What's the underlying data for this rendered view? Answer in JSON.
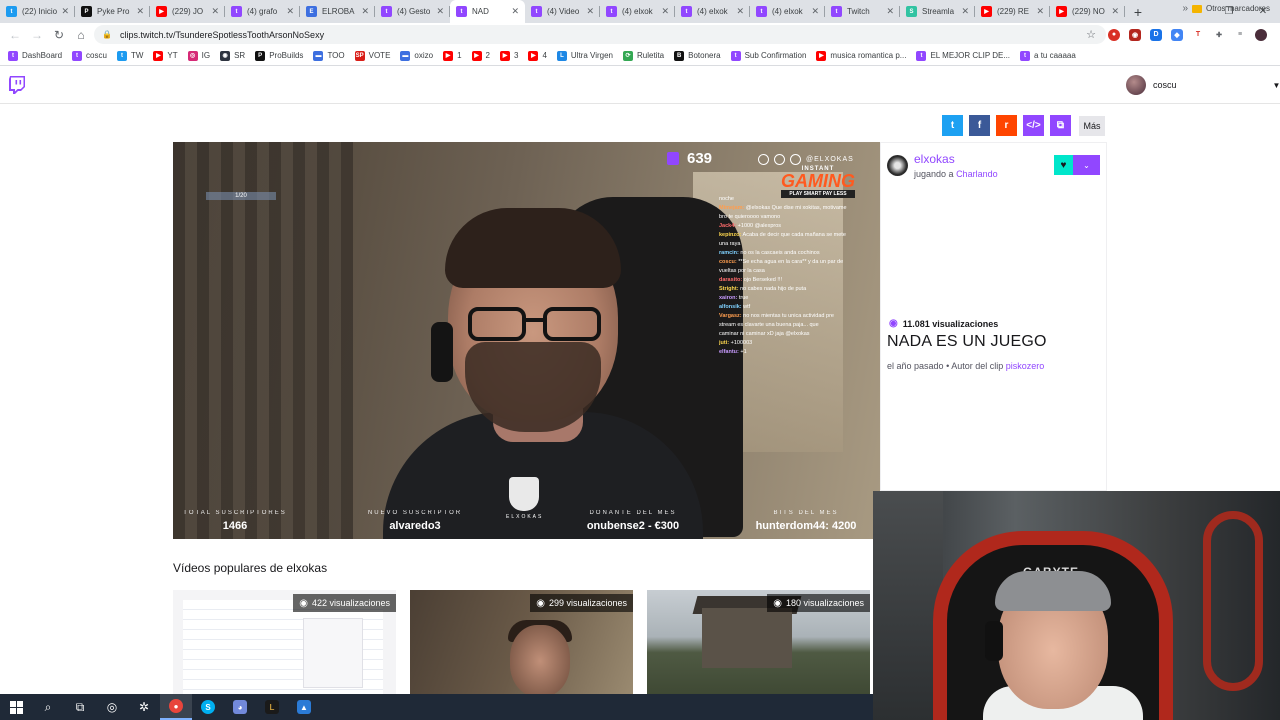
{
  "browser": {
    "tabs": [
      {
        "title": "(22) Inicio",
        "fav_color": "#1d9bf0",
        "glyph": "t"
      },
      {
        "title": "Pyke Pro",
        "fav_color": "#111111",
        "glyph": "P"
      },
      {
        "title": "(229) JO",
        "fav_color": "#ff0000",
        "glyph": "▶"
      },
      {
        "title": "(4) grafo",
        "fav_color": "#9147ff",
        "glyph": "t"
      },
      {
        "title": "ELROBA",
        "fav_color": "#3d6fe0",
        "glyph": "E"
      },
      {
        "title": "(4) Gesto",
        "fav_color": "#9147ff",
        "glyph": "t"
      },
      {
        "title": "NAD",
        "fav_color": "#9147ff",
        "glyph": "t",
        "active": true
      },
      {
        "title": "(4) Video",
        "fav_color": "#9147ff",
        "glyph": "t"
      },
      {
        "title": "(4) elxok",
        "fav_color": "#9147ff",
        "glyph": "t"
      },
      {
        "title": "(4) elxok",
        "fav_color": "#9147ff",
        "glyph": "t"
      },
      {
        "title": "(4) elxok",
        "fav_color": "#9147ff",
        "glyph": "t"
      },
      {
        "title": "Twitch",
        "fav_color": "#9147ff",
        "glyph": "t"
      },
      {
        "title": "Streamla",
        "fav_color": "#31c3a2",
        "glyph": "S"
      },
      {
        "title": "(229) RE",
        "fav_color": "#ff0000",
        "glyph": "▶"
      },
      {
        "title": "(229) NO",
        "fav_color": "#ff0000",
        "glyph": "▶"
      }
    ],
    "new_tab_glyph": "+",
    "window_controls": [
      "–",
      "❐",
      "✕"
    ],
    "url": "clips.twitch.tv/TsundereSpotlessToothArsonNoSexy",
    "bookmarks": [
      {
        "label": "DashBoard",
        "color": "#9147ff",
        "glyph": "t"
      },
      {
        "label": "coscu",
        "color": "#9147ff",
        "glyph": "t"
      },
      {
        "label": "TW",
        "color": "#1d9bf0",
        "glyph": "t"
      },
      {
        "label": "YT",
        "color": "#ff0000",
        "glyph": "▶"
      },
      {
        "label": "IG",
        "color": "#d62976",
        "glyph": "◎"
      },
      {
        "label": "SR",
        "color": "#2e3440",
        "glyph": "◉"
      },
      {
        "label": "ProBuilds",
        "color": "#111111",
        "glyph": "P"
      },
      {
        "label": "TOO",
        "color": "#3d6fe0",
        "glyph": "▬"
      },
      {
        "label": "VOTE",
        "color": "#d91e18",
        "glyph": "SP"
      },
      {
        "label": "oxizo",
        "color": "#3d6fe0",
        "glyph": "▬"
      },
      {
        "label": "1",
        "color": "#ff0000",
        "glyph": "▶"
      },
      {
        "label": "2",
        "color": "#ff0000",
        "glyph": "▶"
      },
      {
        "label": "3",
        "color": "#ff0000",
        "glyph": "▶"
      },
      {
        "label": "4",
        "color": "#ff0000",
        "glyph": "▶"
      },
      {
        "label": "Ultra Virgen",
        "color": "#1e88e5",
        "glyph": "L"
      },
      {
        "label": "Ruletita",
        "color": "#34a853",
        "glyph": "⟳"
      },
      {
        "label": "Botonera",
        "color": "#111111",
        "glyph": "B"
      },
      {
        "label": "Sub Confirmation",
        "color": "#9147ff",
        "glyph": "t"
      },
      {
        "label": "musica romantica p...",
        "color": "#ff0000",
        "glyph": "▶"
      },
      {
        "label": "EL MEJOR CLIP DE...",
        "color": "#9147ff",
        "glyph": "t"
      },
      {
        "label": "a tu caaaaa",
        "color": "#9147ff",
        "glyph": "t"
      }
    ],
    "bookmarks_more": "»",
    "other_bookmarks": "Otros marcadores"
  },
  "header": {
    "username": "coscu"
  },
  "share": {
    "buttons": [
      {
        "name": "twitter-share-button",
        "color": "#1da1f2",
        "glyph": "t"
      },
      {
        "name": "facebook-share-button",
        "color": "#3b5998",
        "glyph": "f"
      },
      {
        "name": "reddit-share-button",
        "color": "#ff4500",
        "glyph": "r"
      },
      {
        "name": "embed-share-button",
        "color": "#9147ff",
        "glyph": "</>"
      },
      {
        "name": "copy-share-button",
        "color": "#9147ff",
        "glyph": "⧉"
      }
    ],
    "more_label": "Más"
  },
  "player": {
    "viewer_count": "639",
    "social_handle": "@ELXOKAS",
    "sponsor_small": "INSTANT",
    "sponsor_big": "GAMING",
    "sponsor_tags": "PLAY SMART  PAY LESS",
    "sub_goal": "1/20",
    "chat": [
      {
        "user": "",
        "msg": "noche"
      },
      {
        "user": "Mimejam:",
        "msg": "@elxokas Que dise mi xokitas, motivame"
      },
      {
        "user": "",
        "msg": "bro te quieroooo vamono"
      },
      {
        "user": "Jack4:",
        "msg": "+1000 @alexpros"
      },
      {
        "user": "kepinzo:",
        "msg": "Acaba de decir que cada mañana se mete"
      },
      {
        "user": "",
        "msg": "una raya"
      },
      {
        "user": "ramcin:",
        "msg": "no os la cascaeis anda cochinos"
      },
      {
        "user": "coscu:",
        "msg": "**Se echa agua en la cara** y da un par de"
      },
      {
        "user": "",
        "msg": "vueltas por la casa"
      },
      {
        "user": "darasito:",
        "msg": "ojo Berseked !!!"
      },
      {
        "user": "Stright:",
        "msg": "no cabes nada hijo de puta"
      },
      {
        "user": "xairon:",
        "msg": "true"
      },
      {
        "user": "alfonsik:",
        "msg": "wtf"
      },
      {
        "user": "Vargasz:",
        "msg": "no nos mientas tu unica actividad pre"
      },
      {
        "user": "",
        "msg": "stream es clavarte una buena paja... que"
      },
      {
        "user": "",
        "msg": "caminar ni caminar xD jaja @elxokas"
      },
      {
        "user": "juti:",
        "msg": "+100003"
      },
      {
        "user": "elfantu:",
        "msg": "+1"
      }
    ],
    "stats": [
      {
        "label": "TOTAL SUSCRIPTORES",
        "value": "1466"
      },
      {
        "label": "NUEVO SUSCRIPTOR",
        "value": "alvaredo3"
      },
      {
        "label": "DONANTE DEL MES",
        "value": "onubense2 - €300"
      },
      {
        "label": "BITS DEL MES",
        "value": "hunterdom44: 4200"
      }
    ],
    "logo_text": "ELXOKAS"
  },
  "clip": {
    "channel": "elxokas",
    "playing_prefix": "jugando a",
    "game": "Charlando",
    "views": "11.081 visualizaciones",
    "title": "NADA ES UN JUEGO",
    "date": "el año pasado",
    "author_prefix": "Autor del clip",
    "author": "piskozero"
  },
  "popular": {
    "title": "Vídeos populares de elxokas",
    "items": [
      {
        "views": "422 visualizaciones"
      },
      {
        "views": "299 visualizaciones"
      },
      {
        "views": "180 visualizaciones"
      }
    ]
  },
  "webcam": {
    "brand_text": "GABYTE"
  }
}
